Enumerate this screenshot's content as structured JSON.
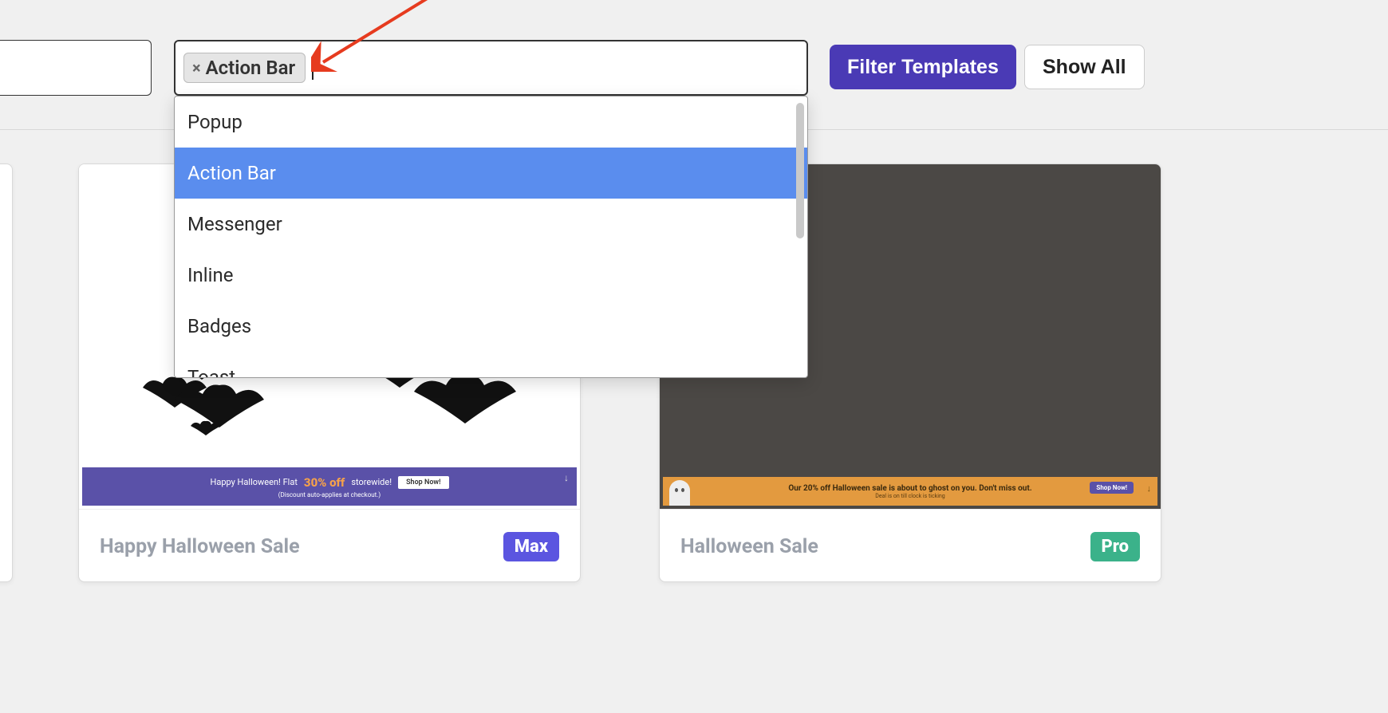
{
  "filter": {
    "selected_tag": "Action Bar",
    "dropdown": {
      "options": [
        "Popup",
        "Action Bar",
        "Messenger",
        "Inline",
        "Badges",
        "Toast"
      ],
      "highlighted_index": 1
    },
    "filter_button_label": "Filter Templates",
    "show_all_label": "Show All"
  },
  "templates": [
    {
      "title": "Happy Halloween Sale",
      "badge": "Max",
      "banner": {
        "line1_prefix": "Happy Halloween! Flat",
        "discount": "30% off",
        "line1_suffix": "storewide!",
        "cta": "Shop Now!",
        "subtext": "(Discount auto-applies at checkout.)"
      }
    },
    {
      "title": "Halloween Sale",
      "badge": "Pro",
      "banner": {
        "line1": "Our 20% off Halloween sale is about to ghost on you. Don't miss out.",
        "cta": "Shop Now!",
        "subtext": "Deal is on till clock is ticking"
      }
    }
  ]
}
